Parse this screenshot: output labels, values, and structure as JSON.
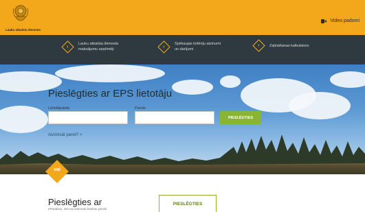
{
  "header": {
    "logo_caption": "Lauku atbalsta dienests",
    "video_link": "Video padomi"
  },
  "nav": {
    "items": [
      {
        "label": "Lauku atbalsta dienesta maksājumu saņēmēji",
        "icon": "chevron-right-icon"
      },
      {
        "label": "Spēkaujas kritēriju atzinumi un darījumi",
        "icon": "chevron-right-icon"
      },
      {
        "label": "Zaļināšanas kalkulators",
        "icon": "chevron-right-icon"
      }
    ]
  },
  "login": {
    "title": "Pieslēgties ar EPS lietotāju",
    "username_label": "Lietotājvārds",
    "username_value": "",
    "password_label": "Parole",
    "password_value": "",
    "submit_label": "PIESLĒGTIES",
    "forgot_label": "Aizmirsāt paroli? >"
  },
  "divider": {
    "label": "vai"
  },
  "alt_login": {
    "title": "Pieslēgties ar",
    "subtitle": "eParakstu, eID vai interneta bankas parolē",
    "button_label": "PIESLĒGTIES"
  },
  "colors": {
    "brand": "#f3a81c",
    "nav_bg": "#2f3a40",
    "accent_green": "#8ab534"
  }
}
